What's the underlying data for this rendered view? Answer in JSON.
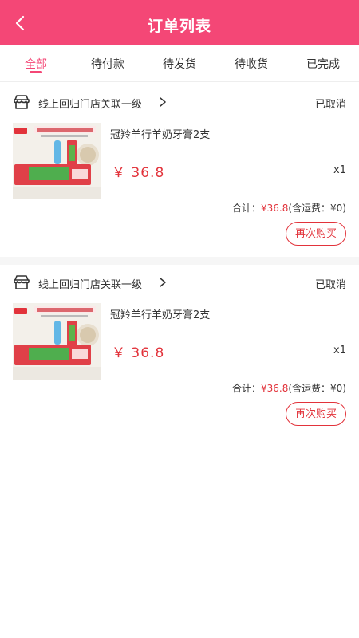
{
  "header": {
    "title": "订单列表"
  },
  "tabs": [
    {
      "label": "全部",
      "active": true
    },
    {
      "label": "待付款",
      "active": false
    },
    {
      "label": "待发货",
      "active": false
    },
    {
      "label": "待收货",
      "active": false
    },
    {
      "label": "已完成",
      "active": false
    }
  ],
  "orders": [
    {
      "store": "线上回归门店关联一级",
      "status": "已取消",
      "product_name": "冠羚羊行羊奶牙膏2支",
      "price": "￥ 36.8",
      "qty": "x1",
      "total_label": "合计：",
      "total_amount": "¥36.8",
      "shipping_note": "(含运费：¥0)",
      "rebuy_label": "再次购买"
    },
    {
      "store": "线上回归门店关联一级",
      "status": "已取消",
      "product_name": "冠羚羊行羊奶牙膏2支",
      "price": "￥ 36.8",
      "qty": "x1",
      "total_label": "合计：",
      "total_amount": "¥36.8",
      "shipping_note": "(含运费：¥0)",
      "rebuy_label": "再次购买"
    }
  ],
  "theme": {
    "header_bg": "#f44776",
    "accent": "#e2333b"
  },
  "icons": {
    "back": "chevron-left-icon",
    "store": "store-icon",
    "chevron": "chevron-right-icon"
  }
}
